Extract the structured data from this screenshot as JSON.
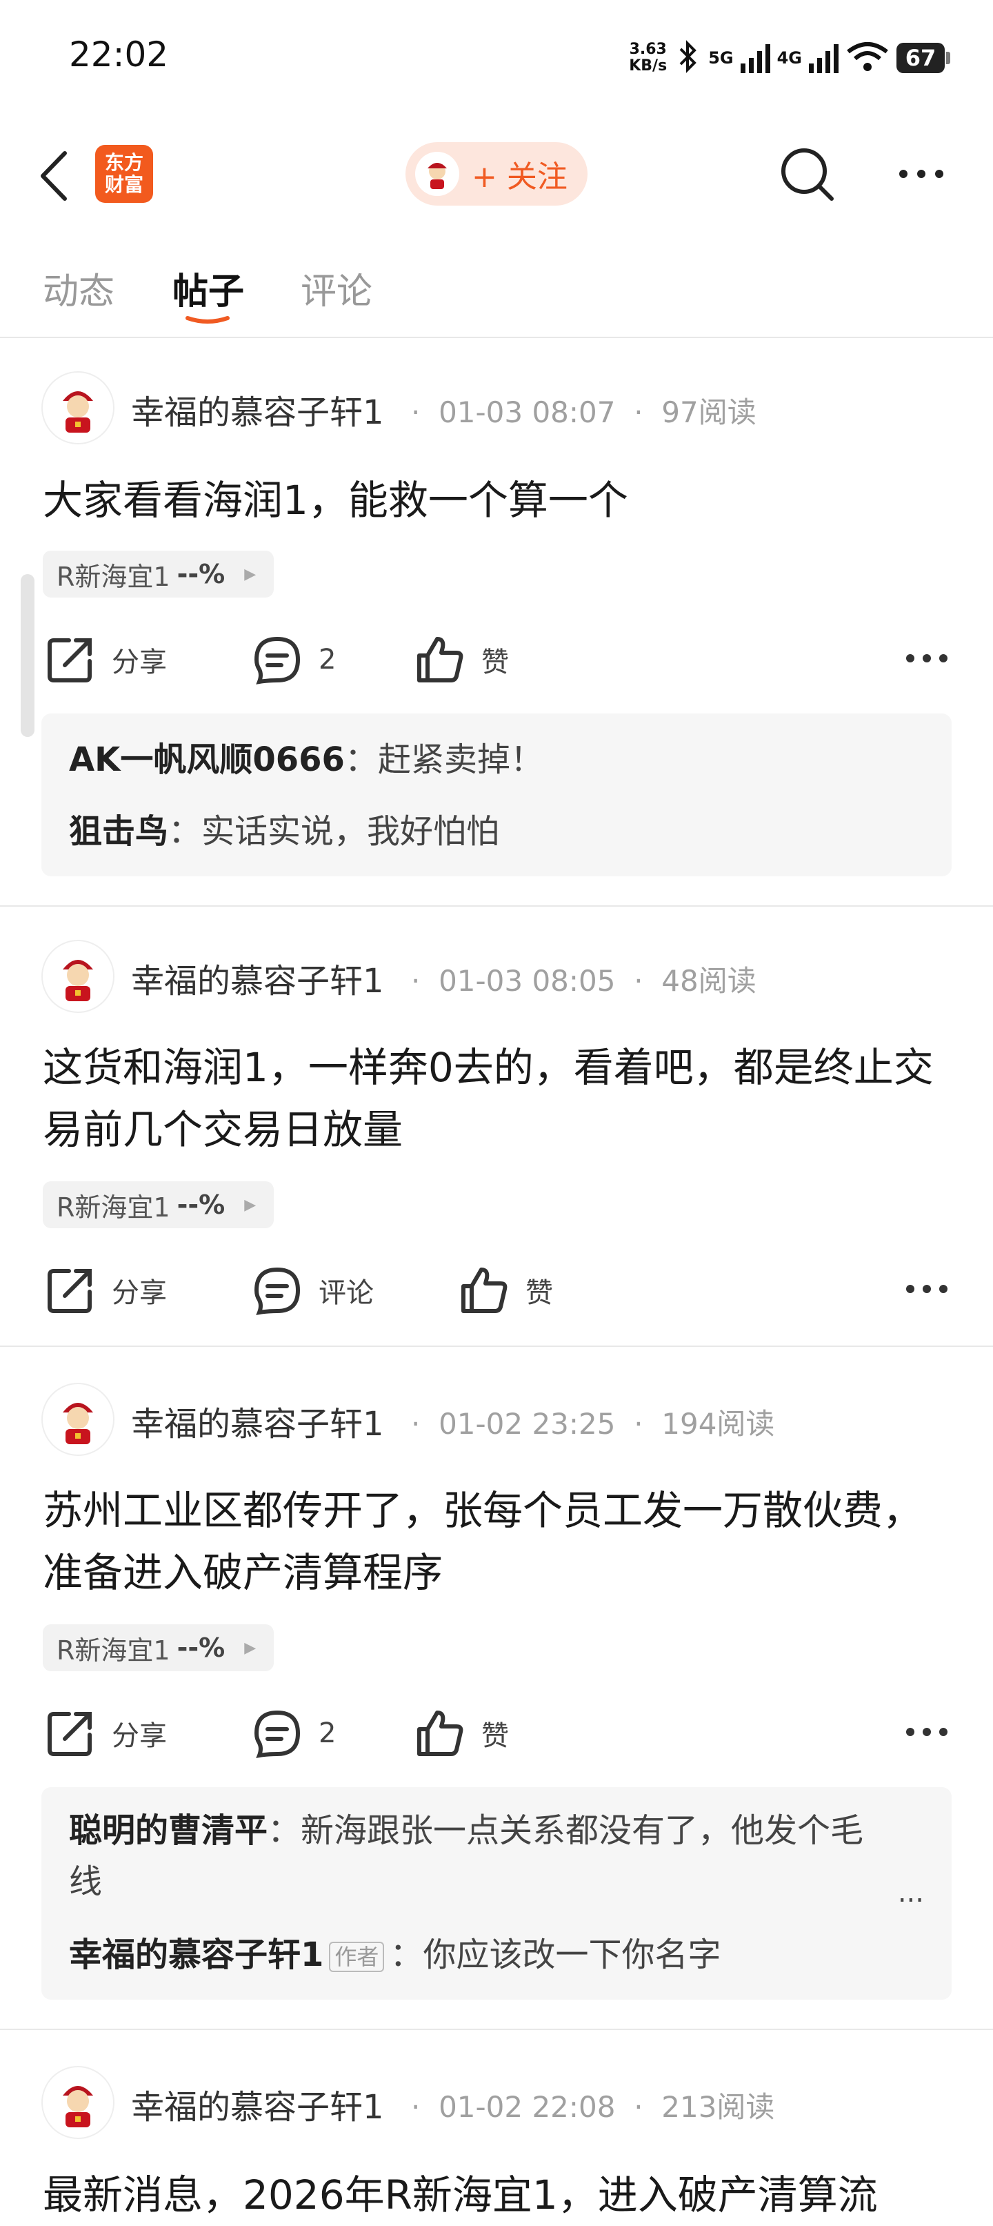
{
  "status_bar": {
    "time": "22:02",
    "net_speed_value": "3.63",
    "net_speed_unit": "KB/s",
    "sig1": "5G",
    "sig2": "4G",
    "wifi_sub": "6",
    "battery": "67"
  },
  "nav": {
    "logo_line1": "东方",
    "logo_line2": "财富",
    "follow": "+ 关注"
  },
  "tabs": [
    "动态",
    "帖子",
    "评论"
  ],
  "colors": {
    "accent": "#f05a22",
    "logo": "#f25a1e"
  },
  "posts": [
    {
      "author": "幸福的慕容子轩1",
      "time": "01-03 08:07",
      "reads": "97阅读",
      "text": "大家看看海润1，能救一个算一个",
      "stock": "R新海宜1",
      "pct": "--%",
      "share": "分享",
      "comment": "2",
      "like": "赞",
      "comments": [
        {
          "user": "AK一帆风顺0666",
          "sep": "：",
          "text": "赶紧卖掉！"
        },
        {
          "user": "狙击鸟",
          "sep": "：",
          "text": "实话实说，我好怕怕"
        }
      ]
    },
    {
      "author": "幸福的慕容子轩1",
      "time": "01-03 08:05",
      "reads": "48阅读",
      "text": "这货和海润1，一样奔0去的，看着吧，都是终止交易前几个交易日放量",
      "stock": "R新海宜1",
      "pct": "--%",
      "share": "分享",
      "comment": "评论",
      "like": "赞"
    },
    {
      "author": "幸福的慕容子轩1",
      "time": "01-02 23:25",
      "reads": "194阅读",
      "text": "苏州工业区都传开了，张每个员工发一万散伙费，准备进入破产清算程序",
      "stock": "R新海宜1",
      "pct": "--%",
      "share": "分享",
      "comment": "2",
      "like": "赞",
      "comments": [
        {
          "user": "聪明的曹清平",
          "sep": "：",
          "text": "新海跟张一点关系都没有了，他发个毛线",
          "more": "..."
        },
        {
          "user": "幸福的慕容子轩1",
          "badge": "作者",
          "sep": "：",
          "text": "你应该改一下你名字"
        }
      ]
    },
    {
      "author": "幸福的慕容子轩1",
      "time": "01-02 22:08",
      "reads": "213阅读",
      "text": "最新消息，2026年R新海宜1，进入破产清算流"
    }
  ]
}
